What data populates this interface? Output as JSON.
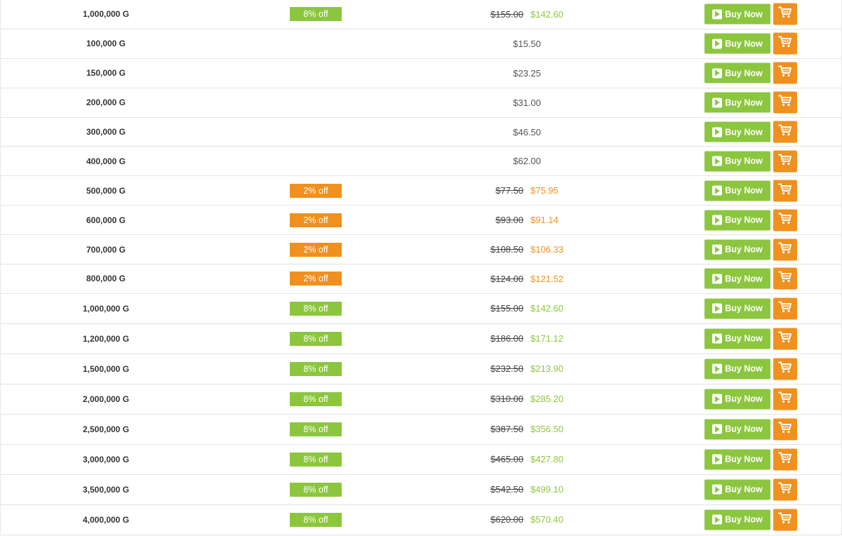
{
  "buy_label": "Buy Now",
  "colors": {
    "green": "#8cc63f",
    "orange": "#f0901e"
  },
  "icons": {
    "buy": "play-icon",
    "cart": "cart-icon"
  },
  "rows": [
    {
      "amount": "1,000,000 G",
      "discount": "8% off",
      "tone": "green",
      "old_price": "$155.00",
      "price": "$142.60"
    },
    {
      "amount": "100,000 G",
      "discount": "",
      "tone": "plain",
      "old_price": "",
      "price": "$15.50"
    },
    {
      "amount": "150,000 G",
      "discount": "",
      "tone": "plain",
      "old_price": "",
      "price": "$23.25"
    },
    {
      "amount": "200,000 G",
      "discount": "",
      "tone": "plain",
      "old_price": "",
      "price": "$31.00"
    },
    {
      "amount": "300,000 G",
      "discount": "",
      "tone": "plain",
      "old_price": "",
      "price": "$46.50"
    },
    {
      "amount": "400,000 G",
      "discount": "",
      "tone": "plain",
      "old_price": "",
      "price": "$62.00"
    },
    {
      "amount": "500,000 G",
      "discount": "2% off",
      "tone": "orange",
      "old_price": "$77.50",
      "price": "$75.95"
    },
    {
      "amount": "600,000 G",
      "discount": "2% off",
      "tone": "orange",
      "old_price": "$93.00",
      "price": "$91.14"
    },
    {
      "amount": "700,000 G",
      "discount": "2% off",
      "tone": "orange",
      "old_price": "$108.50",
      "price": "$106.33"
    },
    {
      "amount": "800,000 G",
      "discount": "2% off",
      "tone": "orange",
      "old_price": "$124.00",
      "price": "$121.52"
    },
    {
      "amount": "1,000,000 G",
      "discount": "8% off",
      "tone": "green",
      "old_price": "$155.00",
      "price": "$142.60"
    },
    {
      "amount": "1,200,000 G",
      "discount": "8% off",
      "tone": "green",
      "old_price": "$186.00",
      "price": "$171.12"
    },
    {
      "amount": "1,500,000 G",
      "discount": "8% off",
      "tone": "green",
      "old_price": "$232.50",
      "price": "$213.90"
    },
    {
      "amount": "2,000,000 G",
      "discount": "8% off",
      "tone": "green",
      "old_price": "$310.00",
      "price": "$285.20"
    },
    {
      "amount": "2,500,000 G",
      "discount": "8% off",
      "tone": "green",
      "old_price": "$387.50",
      "price": "$356.50"
    },
    {
      "amount": "3,000,000 G",
      "discount": "8% off",
      "tone": "green",
      "old_price": "$465.00",
      "price": "$427.80"
    },
    {
      "amount": "3,500,000 G",
      "discount": "8% off",
      "tone": "green",
      "old_price": "$542.50",
      "price": "$499.10"
    },
    {
      "amount": "4,000,000 G",
      "discount": "8% off",
      "tone": "green",
      "old_price": "$620.00",
      "price": "$570.40"
    }
  ]
}
